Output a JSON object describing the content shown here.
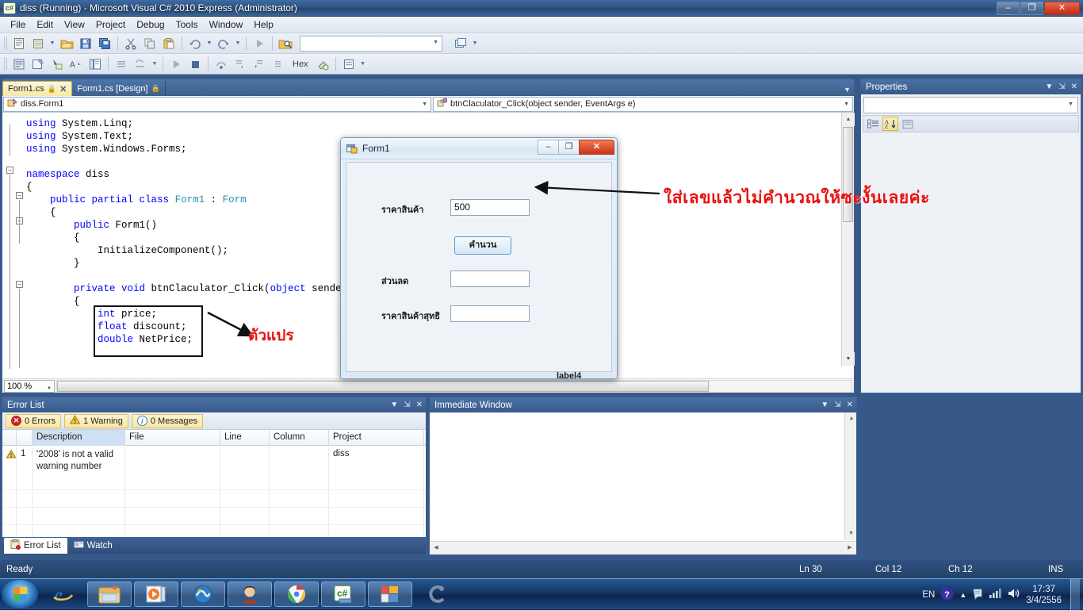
{
  "window": {
    "title": "diss (Running) - Microsoft Visual C# 2010 Express (Administrator)",
    "app_icon": "csharp-icon",
    "minimize_label": "–",
    "maximize_label": "❐",
    "close_label": "✕"
  },
  "menubar": {
    "items": [
      "File",
      "Edit",
      "View",
      "Project",
      "Debug",
      "Tools",
      "Window",
      "Help"
    ]
  },
  "toolbar": {
    "find_combo_value": "",
    "hex_label": "Hex"
  },
  "tabs": [
    {
      "label": "Form1.cs",
      "active": true,
      "locked": true,
      "close_label": "✕"
    },
    {
      "label": "Form1.cs [Design]",
      "active": false,
      "locked": true,
      "close_label": ""
    }
  ],
  "navbar": {
    "class_value": "diss.Form1",
    "member_value": "btnClaculator_Click(object sender, EventArgs e)",
    "caret": "▼"
  },
  "editor": {
    "zoom": "100 %",
    "code_lines": [
      {
        "indent": 0,
        "segments": [
          {
            "t": "using",
            "c": "kw"
          },
          {
            "t": " System.Linq;",
            "c": "plain"
          }
        ]
      },
      {
        "indent": 0,
        "segments": [
          {
            "t": "using",
            "c": "kw"
          },
          {
            "t": " System.Text;",
            "c": "plain"
          }
        ]
      },
      {
        "indent": 0,
        "segments": [
          {
            "t": "using",
            "c": "kw"
          },
          {
            "t": " System.Windows.Forms;",
            "c": "plain"
          }
        ]
      },
      {
        "indent": 0,
        "segments": [
          {
            "t": "",
            "c": "plain"
          }
        ]
      },
      {
        "indent": 0,
        "segments": [
          {
            "t": "namespace",
            "c": "kw"
          },
          {
            "t": " diss",
            "c": "plain"
          }
        ]
      },
      {
        "indent": 0,
        "segments": [
          {
            "t": "{",
            "c": "plain"
          }
        ]
      },
      {
        "indent": 1,
        "segments": [
          {
            "t": "public partial class",
            "c": "kw"
          },
          {
            "t": " ",
            "c": "plain"
          },
          {
            "t": "Form1",
            "c": "ty"
          },
          {
            "t": " : ",
            "c": "plain"
          },
          {
            "t": "Form",
            "c": "ty"
          }
        ]
      },
      {
        "indent": 1,
        "segments": [
          {
            "t": "{",
            "c": "plain"
          }
        ]
      },
      {
        "indent": 2,
        "segments": [
          {
            "t": "public",
            "c": "kw"
          },
          {
            "t": " Form1()",
            "c": "plain"
          }
        ]
      },
      {
        "indent": 2,
        "segments": [
          {
            "t": "{",
            "c": "plain"
          }
        ]
      },
      {
        "indent": 3,
        "segments": [
          {
            "t": "InitializeComponent();",
            "c": "plain"
          }
        ]
      },
      {
        "indent": 2,
        "segments": [
          {
            "t": "}",
            "c": "plain"
          }
        ]
      },
      {
        "indent": 0,
        "segments": [
          {
            "t": "",
            "c": "plain"
          }
        ]
      },
      {
        "indent": 2,
        "segments": [
          {
            "t": "private void",
            "c": "kw"
          },
          {
            "t": " btnClaculator_Click(",
            "c": "plain"
          },
          {
            "t": "object",
            "c": "kw"
          },
          {
            "t": " sender,",
            "c": "plain"
          }
        ]
      },
      {
        "indent": 2,
        "segments": [
          {
            "t": "{",
            "c": "plain"
          }
        ]
      },
      {
        "indent": 3,
        "segments": [
          {
            "t": "int",
            "c": "kw"
          },
          {
            "t": " price;",
            "c": "plain"
          }
        ]
      },
      {
        "indent": 3,
        "segments": [
          {
            "t": "float",
            "c": "kw"
          },
          {
            "t": " discount;",
            "c": "plain"
          }
        ]
      },
      {
        "indent": 3,
        "segments": [
          {
            "t": "double",
            "c": "kw"
          },
          {
            "t": " NetPrice;",
            "c": "plain"
          }
        ]
      }
    ]
  },
  "properties": {
    "title": "Properties",
    "combo_value": "",
    "buttons": {
      "categorized": "categorized-icon",
      "alphabetical": "alphabetical-sort-icon",
      "property_pages": "property-pages-icon"
    },
    "dropdown_label": "▼",
    "pin_label": "⇲",
    "close_label": "✕"
  },
  "error_list": {
    "title": "Error List",
    "filters": [
      {
        "label": "0 Errors",
        "icon": "error-icon",
        "color": "#c8232c"
      },
      {
        "label": "1 Warning",
        "icon": "warning-icon",
        "color": "#e8b52a"
      },
      {
        "label": "0 Messages",
        "icon": "info-icon",
        "color": "#3f7fc1"
      }
    ],
    "columns": [
      "",
      "",
      "Description",
      "File",
      "Line",
      "Column",
      "Project"
    ],
    "rows": [
      {
        "num": "1",
        "icon": "warning-icon",
        "description": "'2008' is not a valid warning number",
        "file": "",
        "line": "",
        "column": "",
        "project": "diss"
      }
    ],
    "tabs": [
      {
        "label": "Error List",
        "icon": "error-list-icon",
        "active": true
      },
      {
        "label": "Watch",
        "icon": "watch-icon",
        "active": false
      }
    ],
    "dropdown_label": "▼",
    "pin_label": "⇲",
    "close_label": "✕"
  },
  "immediate_window": {
    "title": "Immediate Window",
    "content": "",
    "dropdown_label": "▼",
    "pin_label": "⇲",
    "close_label": "✕"
  },
  "statusbar": {
    "ready": "Ready",
    "line": "Ln 30",
    "col": "Col 12",
    "ch": "Ch 12",
    "insert_mode": "INS"
  },
  "form1": {
    "title": "Form1",
    "icon": "form-icon",
    "minimize_label": "–",
    "maximize_label": "❐",
    "close_label": "✕",
    "fields": [
      {
        "label": "ราคาสินค้า",
        "value": "500",
        "name": "price-input"
      },
      {
        "label": "ส่วนลด",
        "value": "",
        "name": "discount-input"
      },
      {
        "label": "ราคาสินค้าสุทธิ",
        "value": "",
        "name": "netprice-input"
      }
    ],
    "button_label": "คำนวน",
    "label4": "label4"
  },
  "annotations": [
    {
      "id": "note-calc",
      "text": "ใส่เลขแล้วไม่คำนวณให้ซะงั้นเลยค่ะ",
      "color": "#e8110f"
    },
    {
      "id": "note-vars",
      "text": "ตัวแปร",
      "color": "#e8110f"
    }
  ],
  "taskbar": {
    "start_label": "windows-start-orb",
    "items": [
      {
        "name": "internet-explorer",
        "glyph": "e"
      },
      {
        "name": "windows-explorer",
        "glyph": "▤"
      },
      {
        "name": "media-player",
        "glyph": "▶"
      },
      {
        "name": "app-blue-globe",
        "glyph": "◉"
      },
      {
        "name": "app-character",
        "glyph": "☺"
      },
      {
        "name": "google-chrome",
        "glyph": "●"
      },
      {
        "name": "visual-csharp-express",
        "glyph": "c#"
      },
      {
        "name": "form-designer-window",
        "glyph": "▣"
      },
      {
        "name": "app-orange-swirl",
        "glyph": "⟲"
      }
    ],
    "tray": {
      "language": "EN",
      "help_icon": "help-icon",
      "show_hidden_icon": "chevron-up-icon",
      "action_center_icon": "flag-icon",
      "network_icon": "network-bars-icon",
      "volume_icon": "speaker-icon",
      "time": "17:37",
      "date": "3/4/2556"
    }
  }
}
